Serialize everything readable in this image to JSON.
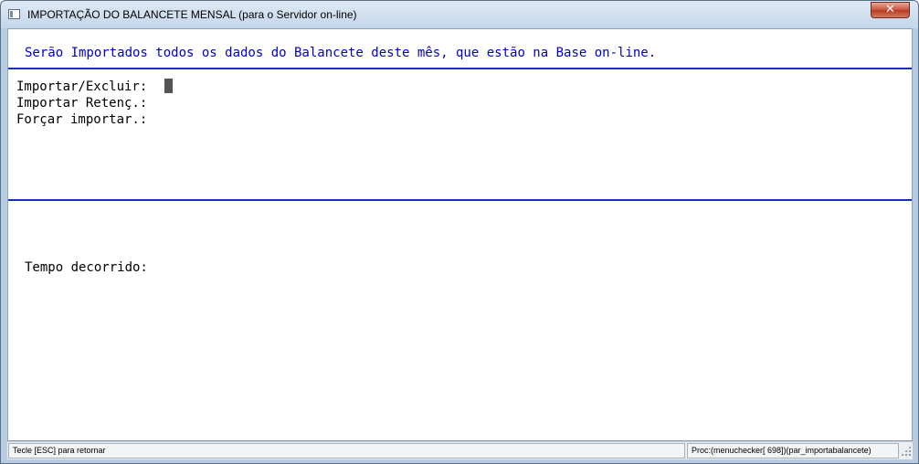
{
  "window": {
    "title": "IMPORTAÇÃO DO BALANCETE MENSAL (para o Servidor on-line)",
    "close_label": "✕"
  },
  "content": {
    "header": "Serão Importados todos os dados do Balancete deste mês, que estão na Base on-line.",
    "fields": [
      {
        "label": "Importar/Excluir:",
        "value": ""
      },
      {
        "label": "Importar Retenç.:",
        "value": ""
      },
      {
        "label": "Forçar importar.:",
        "value": ""
      }
    ],
    "elapsed_label": "Tempo decorrido:"
  },
  "statusbar": {
    "left": "Tecle [ESC] para retornar",
    "right": "Proc:(menuchecker[  698])(par_importabalancete)"
  },
  "colors": {
    "header_text": "#0000c8",
    "rule": "#1a2fb0",
    "cursor": "#555555"
  }
}
